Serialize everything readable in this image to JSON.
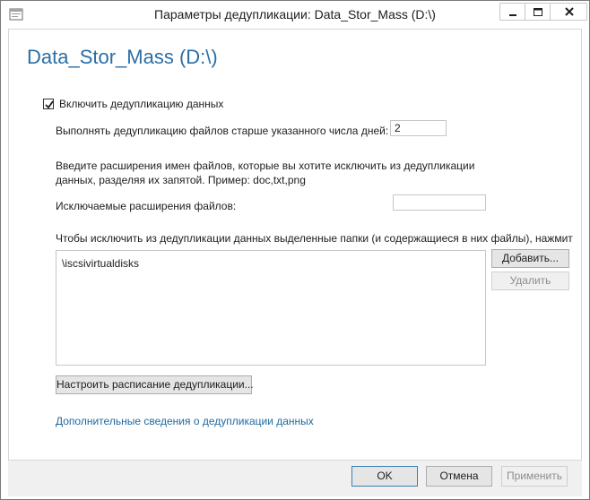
{
  "window": {
    "title": "Параметры дедупликации: Data_Stor_Mass (D:\\)",
    "controls": {
      "minimize": "minimize-icon",
      "maximize": "maximize-icon",
      "close": "close-icon"
    }
  },
  "page": {
    "heading": "Data_Stor_Mass (D:\\)"
  },
  "dedup": {
    "enable_label": "Включить дедупликацию данных",
    "enabled": true,
    "days_label": "Выполнять дедупликацию файлов старше указанного числа дней:",
    "days_value": "2",
    "extensions_info_line1": "Введите расширения имен файлов, которые вы хотите исключить из дедупликации",
    "extensions_info_line2": "данных, разделяя их запятой. Пример: doc,txt,png",
    "excluded_ext_label": "Исключаемые расширения файлов:",
    "excluded_ext_value": "",
    "folders_info": "Чтобы исключить из дедупликации данных выделенные папки (и содержащиеся в них файлы), нажмит",
    "excluded_folders": [
      "\\iscsivirtualdisks"
    ],
    "add_button": "Добавить...",
    "remove_button": "Удалить",
    "schedule_button": "Настроить расписание дедупликации...",
    "more_info_link": "Дополнительные сведения о дедупликации данных"
  },
  "footer": {
    "ok": "OK",
    "cancel": "Отмена",
    "apply": "Применить"
  },
  "colors": {
    "heading": "#2a6ea6",
    "link": "#1e6a9f",
    "footer_bg": "#f0f0f0"
  }
}
